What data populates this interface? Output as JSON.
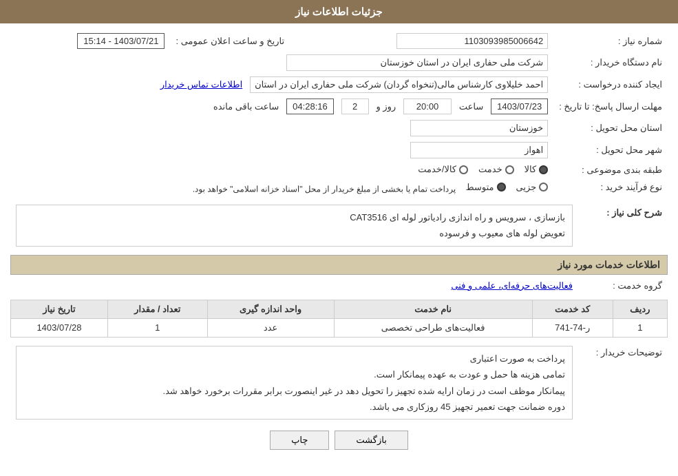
{
  "header": {
    "title": "جزئیات اطلاعات نیاز"
  },
  "fields": {
    "shomareNiaz_label": "شماره نیاز :",
    "shomareNiaz_value": "1103093985006642",
    "namDastgah_label": "نام دستگاه خریدار :",
    "namDastgah_value": "شرکت ملی حفاری ایران در استان خوزستان",
    "tarikhoSaat_label": "تاریخ و ساعت اعلان عمومی :",
    "tarikhoSaat_value": "1403/07/21 - 15:14",
    "ijadKonande_label": "ایجاد کننده درخواست :",
    "ijadKonande_value": "احمد خلیلاوی کارشناس مالی(تنخواه گردان) شرکت ملی حفاری ایران در استان",
    "etelaat_link": "اطلاعات تماس خریدار",
    "mohlat_label": "مهلت ارسال پاسخ: تا تاریخ :",
    "mohlat_date": "1403/07/23",
    "mohlat_saat_label": "ساعت",
    "mohlat_saat_value": "20:00",
    "mohlat_roz_label": "روز و",
    "mohlat_roz_value": "2",
    "mohlat_remaining": "04:28:16",
    "mohlat_remaining_label": "ساعت باقی مانده",
    "ostan_label": "استان محل تحویل :",
    "ostan_value": "خوزستان",
    "shahr_label": "شهر محل تحویل :",
    "shahr_value": "اهواز",
    "tabaqe_label": "طبقه بندی موضوعی :",
    "tabaqe_kala": "کالا",
    "tabaqe_khadamat": "خدمت",
    "tabaqe_kalaKhadamat": "کالا/خدمت",
    "noeFarayand_label": "نوع فرآیند خرید :",
    "noeFarayand_jozii": "جزیی",
    "noeFarayand_motevaset": "متوسط",
    "noeFarayand_note": "پرداخت تمام یا بخشی از مبلغ خریدار از محل \"اسناد خزانه اسلامی\" خواهد بود.",
    "sharh_label": "شرح کلی نیاز :",
    "sharh_line1": "بازسازی ، سرویس و راه اندازی رادیاتور لوله ای CAT3516",
    "sharh_line2": "تعویض لوله های معیوب و فرسوده",
    "services_section_title": "اطلاعات خدمات مورد نیاز",
    "group_label": "گروه خدمت :",
    "group_value": "فعالیت‌های حرفه‌ای، علمی و فنی",
    "table_headers": [
      "ردیف",
      "کد خدمت",
      "نام خدمت",
      "واحد اندازه گیری",
      "تعداد / مقدار",
      "تاریخ نیاز"
    ],
    "table_rows": [
      {
        "row": "1",
        "code": "ر-74-741",
        "name": "فعالیت‌های طراحی تخصصی",
        "unit": "عدد",
        "quantity": "1",
        "date": "1403/07/28"
      }
    ],
    "toozihat_label": "توضیحات خریدار :",
    "toozihat_line1": "پرداخت به صورت اعتباری",
    "toozihat_line2": "تمامی هزینه ها حمل و عودت به عهده پیمانکار است.",
    "toozihat_line3": "پیمانکار موظف است در زمان ارایه شده تجهیز را تحویل دهد در غیر اینصورت برابر مقررات برخورد خواهد شد.",
    "toozihat_line4": "دوره ضمانت جهت تعمیر تجهیز 45 روزکاری می باشد.",
    "btn_back": "بازگشت",
    "btn_print": "چاپ"
  }
}
